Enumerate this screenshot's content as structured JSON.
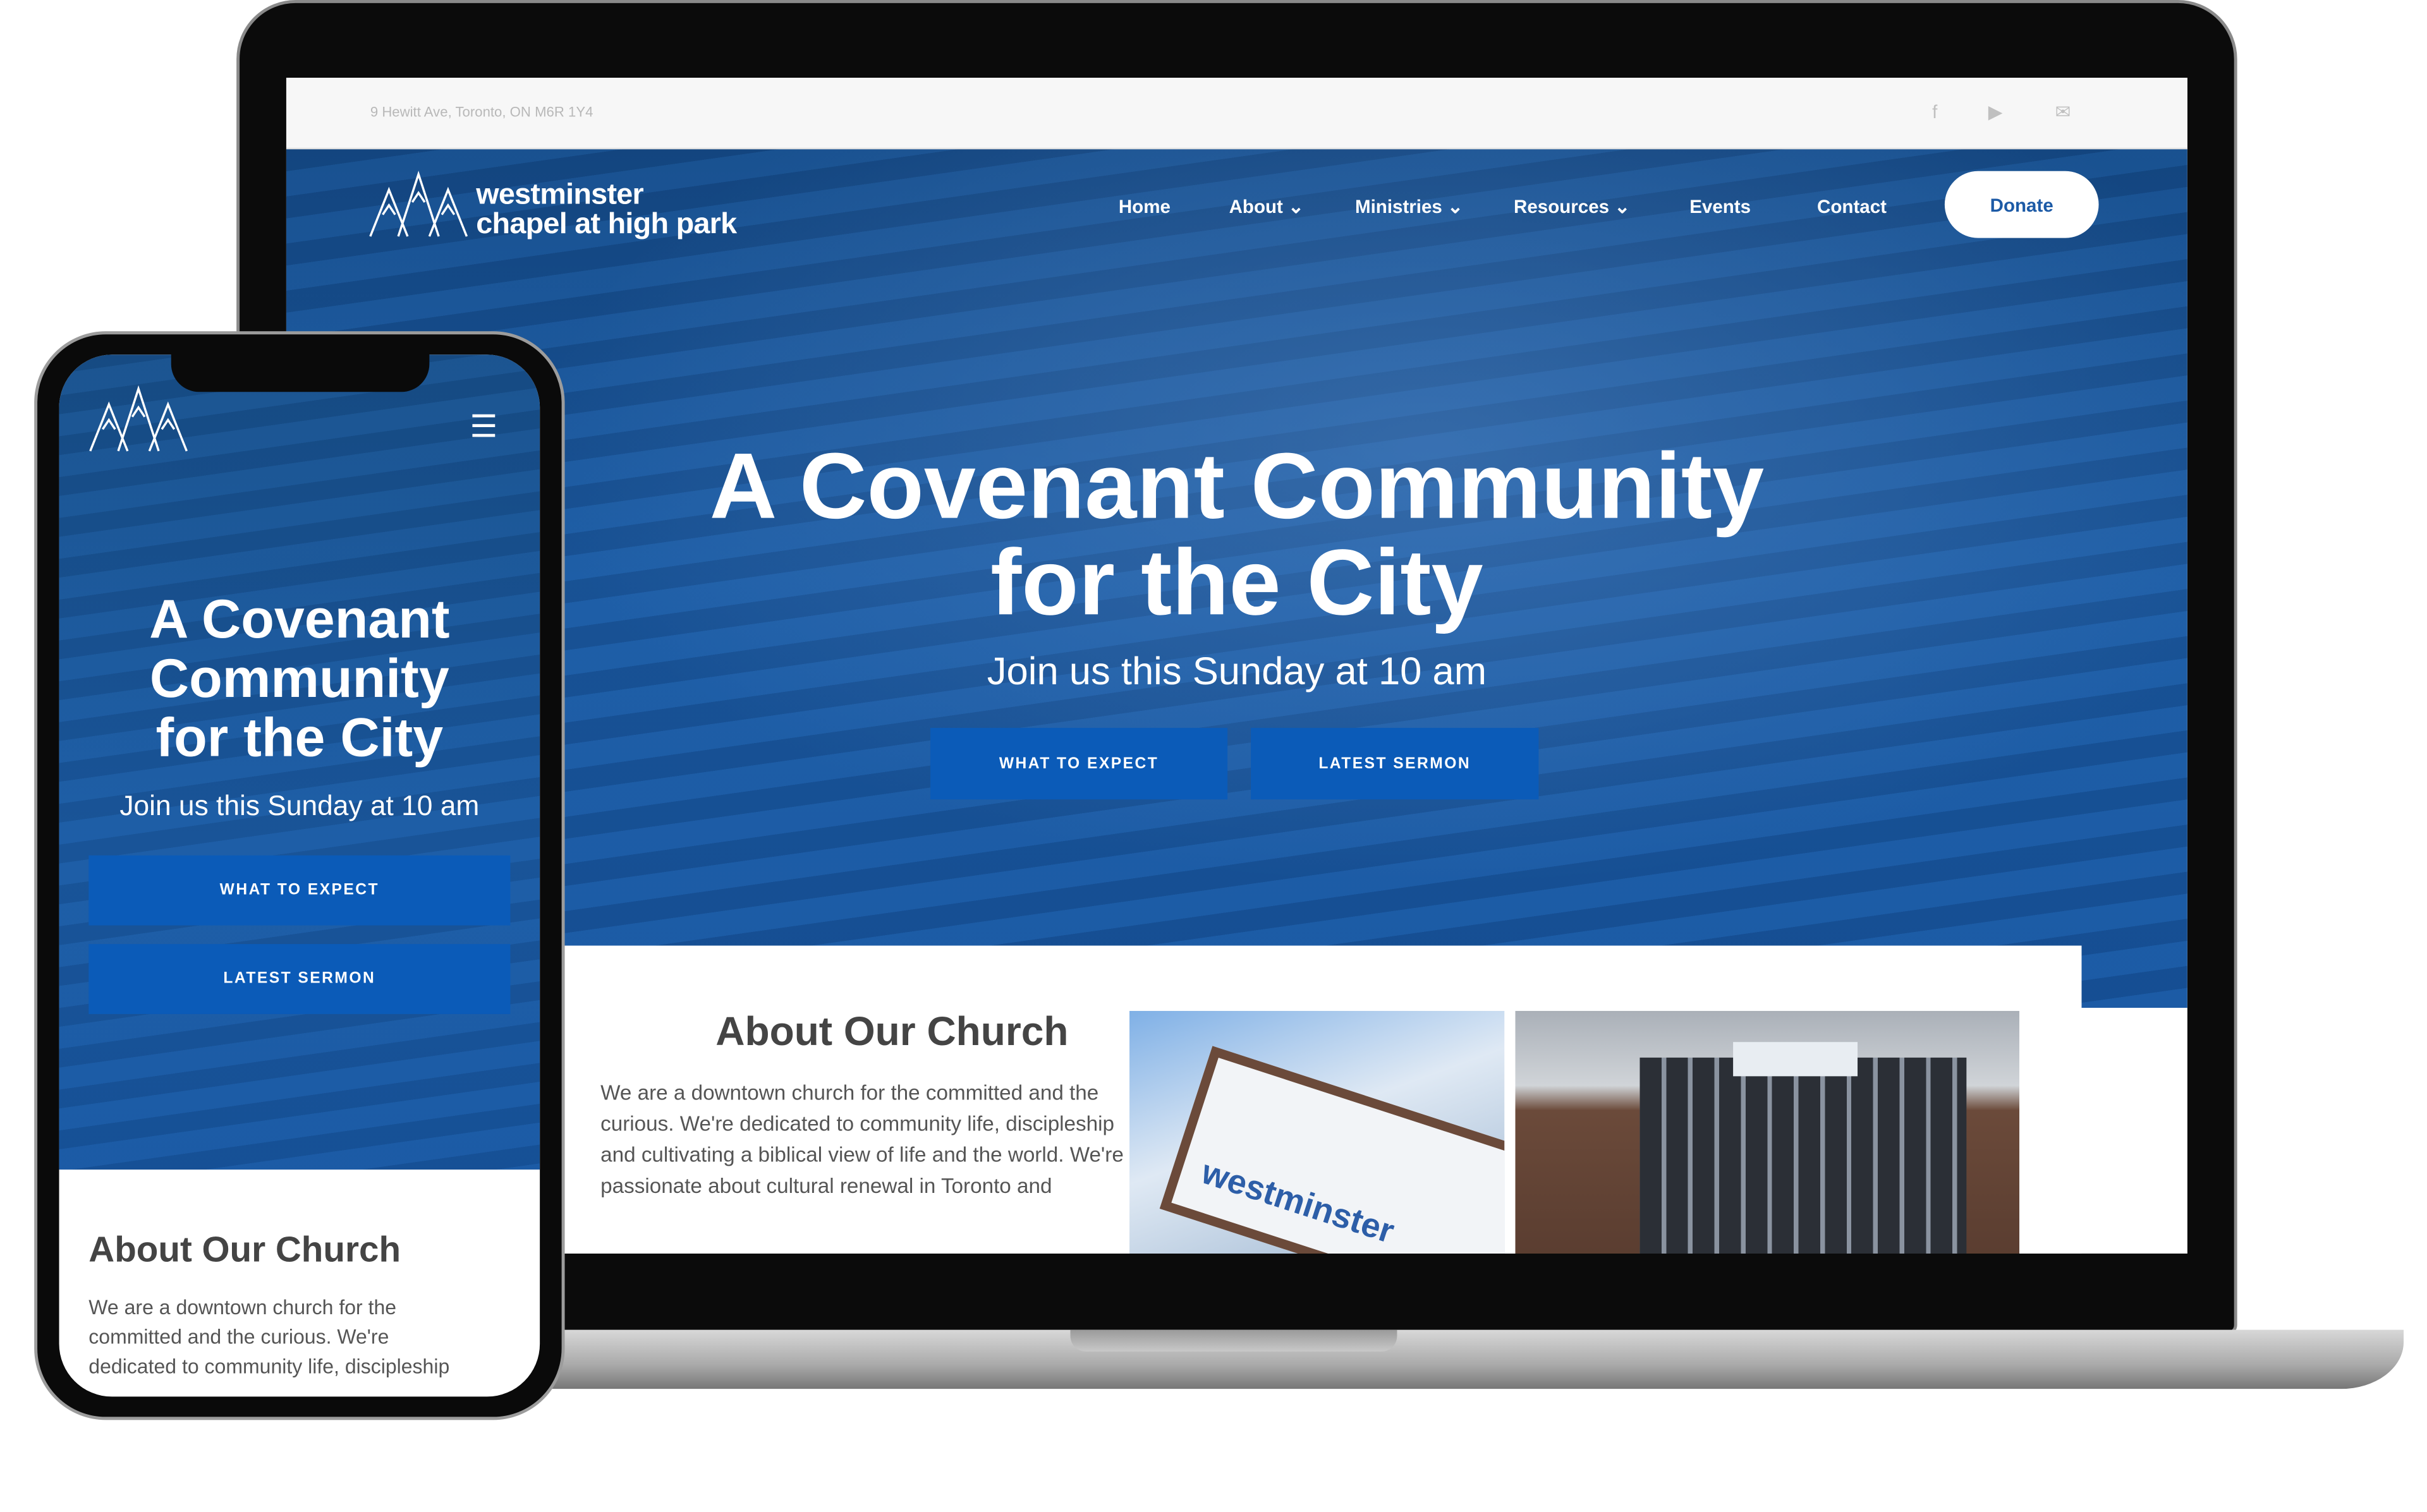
{
  "site": {
    "address": "9 Hewitt Ave, Toronto, ON M6R 1Y4",
    "social_icons": [
      "facebook-icon",
      "youtube-icon",
      "email-icon"
    ],
    "logo_line1": "westminster",
    "logo_line2": "chapel at high park",
    "nav": [
      {
        "label": "Home"
      },
      {
        "label": "About",
        "dropdown": true
      },
      {
        "label": "Ministries",
        "dropdown": true
      },
      {
        "label": "Resources",
        "dropdown": true
      },
      {
        "label": "Events"
      },
      {
        "label": "Contact"
      }
    ],
    "donate_label": "Donate",
    "hero": {
      "title_line1": "A Covenant Community",
      "title_line2": "for the City",
      "subtitle": "Join us this Sunday at 10 am",
      "btn1": "WHAT TO EXPECT",
      "btn2": "LATEST SERMON"
    },
    "about": {
      "heading": "About Our Church",
      "lines": [
        "We are a downtown church for the committed and the",
        "curious. We're dedicated to community life, discipleship",
        "and cultivating a biblical view of life and the world. We're",
        "passionate about cultural renewal in Toronto and"
      ],
      "sign_text": "westminster"
    }
  },
  "mobile": {
    "title_line1": "A Covenant",
    "title_line2": "Community",
    "title_line3": "for the City",
    "subtitle": "Join us this Sunday at 10 am",
    "btn1": "WHAT TO EXPECT",
    "btn2": "LATEST SERMON",
    "about_heading": "About Our Church",
    "about_lines": [
      "We are a downtown church for the",
      "committed and the curious. We're",
      "dedicated to community life, discipleship"
    ]
  },
  "colors": {
    "brand_blue": "#1c5aa6",
    "button_blue": "#0b5bb8"
  }
}
